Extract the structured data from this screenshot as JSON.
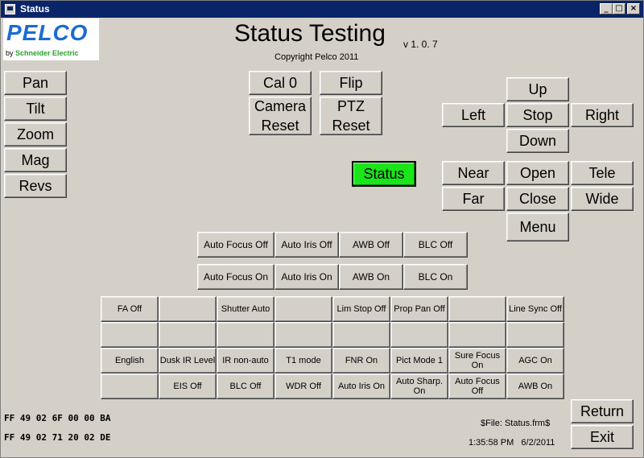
{
  "window": {
    "title": "Status"
  },
  "logo": {
    "brand": "PELCO",
    "tagline_by": "by",
    "tagline_company": "Schneider Electric"
  },
  "header": {
    "title": "Status Testing",
    "version": "v 1. 0. 7",
    "copyright": "Copyright Pelco 2011"
  },
  "left_buttons": [
    "Pan",
    "Tilt",
    "Zoom",
    "Mag",
    "Revs"
  ],
  "center_buttons": {
    "cal0": "Cal 0",
    "flip": "Flip",
    "camera_reset": "Camera Reset",
    "ptz_reset": "PTZ Reset"
  },
  "status_button": "Status",
  "colors": {
    "status_green": "#19e519",
    "title_bar": "#0a246a",
    "face": "#d4d0c8"
  },
  "direction": {
    "up": "Up",
    "left": "Left",
    "stop": "Stop",
    "right": "Right",
    "down": "Down"
  },
  "lens": {
    "near": "Near",
    "open": "Open",
    "tele": "Tele",
    "far": "Far",
    "close": "Close",
    "wide": "Wide",
    "menu": "Menu"
  },
  "auto_off_row": [
    "Auto Focus Off",
    "Auto Iris Off",
    "AWB Off",
    "BLC Off"
  ],
  "auto_on_row": [
    "Auto Focus On",
    "Auto Iris On",
    "AWB On",
    "BLC On"
  ],
  "grid": [
    [
      "FA Off",
      "",
      "Shutter Auto",
      "",
      "Lim Stop Off",
      "Prop Pan Off",
      "",
      "Line Sync Off"
    ],
    [
      "",
      "",
      "",
      "",
      "",
      "",
      "",
      ""
    ],
    [
      "English",
      "Dusk IR Level",
      "IR non-auto",
      "T1 mode",
      "FNR On",
      "Pict Mode 1",
      "Sure Focus On",
      "AGC On"
    ],
    [
      "",
      "EIS Off",
      "BLC Off",
      "WDR Off",
      "Auto Iris On",
      "Auto Sharp. On",
      "Auto Focus Off",
      "AWB On"
    ]
  ],
  "hex_lines": [
    "FF 49 02 6F 00 00 BA",
    "FF 49 02 71 20 02 DE"
  ],
  "file_label": "$File: Status.frm$",
  "timestamp": "1:35:58 PM   6/2/2011",
  "bottom_buttons": {
    "return": "Return",
    "exit": "Exit"
  }
}
